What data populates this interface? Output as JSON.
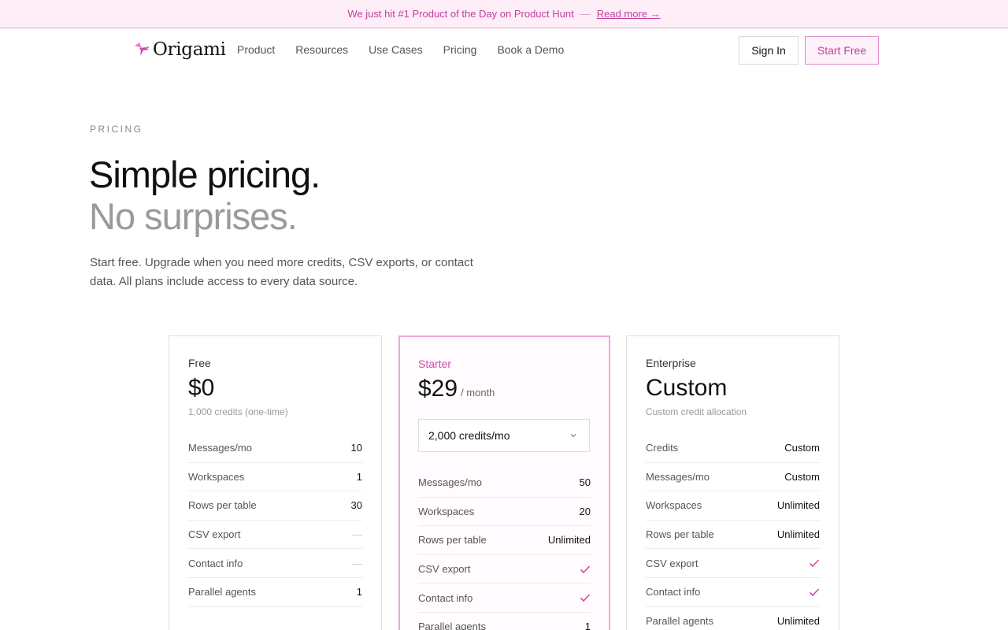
{
  "banner": {
    "text": "We just hit #1 Product of the Day on Product Hunt",
    "separator": "—",
    "link": "Read more →"
  },
  "nav": {
    "logo_text": "Origami",
    "links": [
      "Product",
      "Resources",
      "Use Cases",
      "Pricing",
      "Book a Demo"
    ],
    "sign_in": "Sign In",
    "start_free": "Start Free"
  },
  "hero": {
    "eyebrow": "PRICING",
    "title": "Simple pricing.",
    "subtitle": "No surprises.",
    "lead": "Start free. Upgrade when you need more credits, CSV exports, or contact data. All plans include access to every data source."
  },
  "plans": [
    {
      "name": "Free",
      "price": "$0",
      "note": "1,000 credits (one-time)",
      "rows": [
        {
          "k": "Messages/mo",
          "v": "10"
        },
        {
          "k": "Workspaces",
          "v": "1"
        },
        {
          "k": "Rows per table",
          "v": "30"
        },
        {
          "k": "CSV export",
          "v": "—"
        },
        {
          "k": "Contact info",
          "v": "—"
        },
        {
          "k": "Parallel agents",
          "v": "1"
        }
      ]
    },
    {
      "name": "Starter",
      "price": "$29",
      "price_suffix": "/ month",
      "credit_select": "2,000 credits/mo",
      "rows": [
        {
          "k": "Messages/mo",
          "v": "50"
        },
        {
          "k": "Workspaces",
          "v": "20"
        },
        {
          "k": "Rows per table",
          "v": "Unlimited"
        },
        {
          "k": "CSV export",
          "v": "check"
        },
        {
          "k": "Contact info",
          "v": "check"
        },
        {
          "k": "Parallel agents",
          "v": "1"
        }
      ]
    },
    {
      "name": "Enterprise",
      "price": "Custom",
      "note": "Custom credit allocation",
      "rows": [
        {
          "k": "Credits",
          "v": "Custom"
        },
        {
          "k": "Messages/mo",
          "v": "Custom"
        },
        {
          "k": "Workspaces",
          "v": "Unlimited"
        },
        {
          "k": "Rows per table",
          "v": "Unlimited"
        },
        {
          "k": "CSV export",
          "v": "check"
        },
        {
          "k": "Contact info",
          "v": "check"
        },
        {
          "k": "Parallel agents",
          "v": "Unlimited"
        }
      ]
    }
  ],
  "colors": {
    "accent": "#c23f9d",
    "accent_light": "#fdeef8",
    "check": "#d24aa8"
  },
  "icons": {
    "logo": "bird-logo-icon",
    "check": "check-icon",
    "dropdown": "chevron-down-icon"
  }
}
